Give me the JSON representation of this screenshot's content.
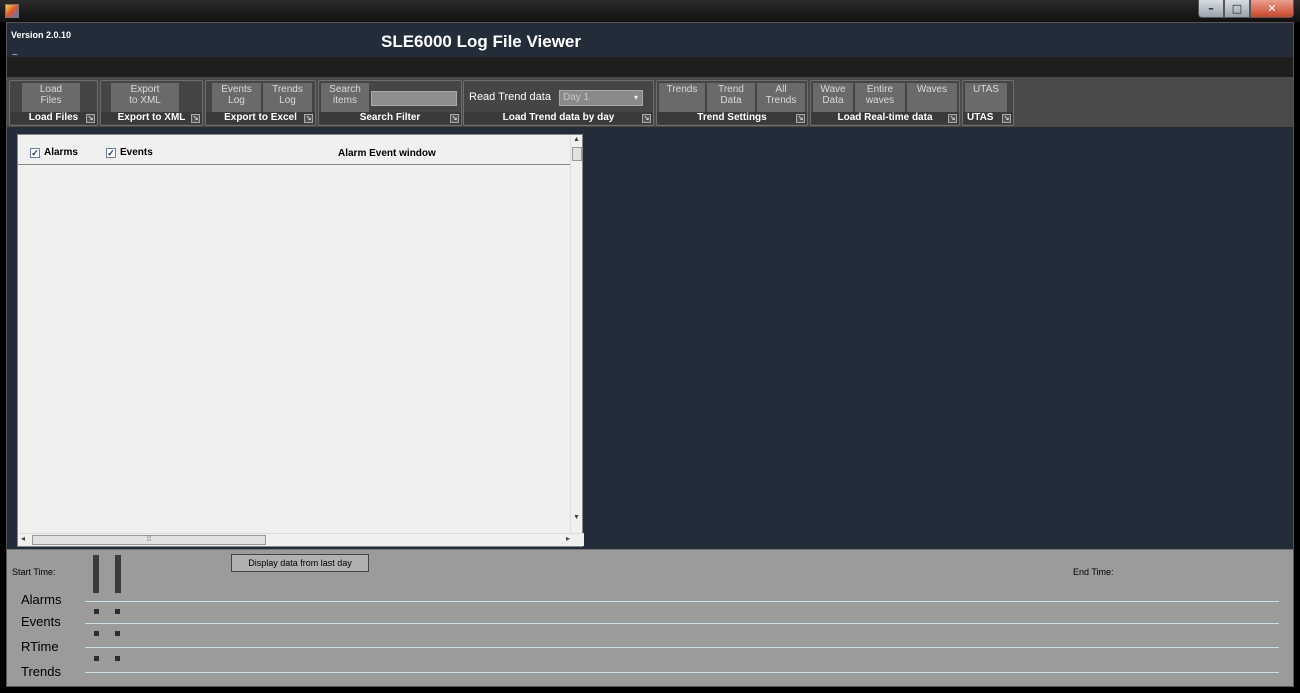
{
  "window": {
    "version": "Version 2.0.10",
    "title": "SLE6000 Log File Viewer",
    "menu_glyph": "~"
  },
  "ribbon": {
    "groups": [
      {
        "title": "Load Files",
        "buttons": [
          "Load\nFiles"
        ]
      },
      {
        "title": "Export to XML",
        "buttons": [
          "Export\nto XML"
        ]
      },
      {
        "title": "Export to Excel",
        "buttons": [
          "Events\nLog",
          "Trends\nLog"
        ]
      },
      {
        "title": "Search Filter",
        "buttons": [
          "Search\nitems"
        ],
        "search_value": ""
      },
      {
        "title": "Load Trend data by day",
        "label": "Read Trend data",
        "select_value": "Day 1"
      },
      {
        "title": "Trend Settings",
        "buttons": [
          "Trends",
          "Trend\nData",
          "All\nTrends"
        ]
      },
      {
        "title": "Load Real-time data",
        "buttons": [
          "Wave\nData",
          "Entire\nwaves",
          "Waves"
        ]
      },
      {
        "title": "UTAS",
        "buttons": [
          "UTAS"
        ]
      }
    ]
  },
  "alarm_panel": {
    "alarms_label": "Alarms",
    "alarms_checked": true,
    "events_label": "Events",
    "events_checked": true,
    "title": "Alarm Event window"
  },
  "timeline": {
    "start_label": "Start Time:",
    "end_label": "End Time:",
    "last_day_button": "Display data from last day",
    "rows": [
      "Alarms",
      "Events",
      "RTime",
      "Trends"
    ]
  }
}
